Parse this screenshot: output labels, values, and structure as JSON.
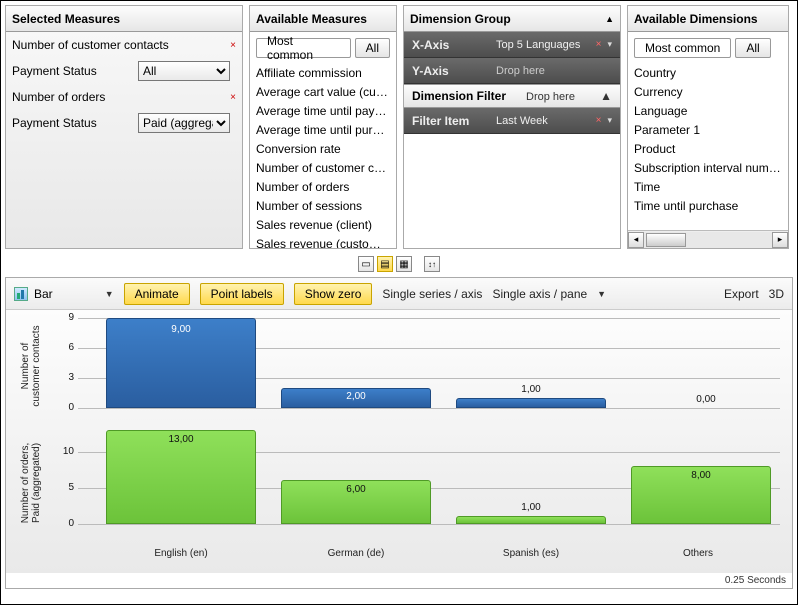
{
  "selected_measures": {
    "header": "Selected Measures",
    "rows": [
      {
        "label": "Number of customer contacts",
        "del": "×"
      },
      {
        "label": "Payment Status",
        "combo_value": "All"
      },
      {
        "label": "Number of orders",
        "del": "×"
      },
      {
        "label2": "Payment Status",
        "combo_value2": "Paid (aggrega"
      }
    ]
  },
  "available_measures": {
    "header": "Available Measures",
    "tabs": {
      "common": "Most common",
      "all": "All"
    },
    "items": [
      "Affiliate commission",
      "Average cart value (cus…",
      "Average time until pay…",
      "Average time until purc…",
      "Conversion rate",
      "Number of customer c…",
      "Number of orders",
      "Number of sessions",
      "Sales revenue (client)",
      "Sales revenue (customer)"
    ]
  },
  "dimension_group": {
    "header": "Dimension Group",
    "x_label": "X-Axis",
    "x_value": "Top 5 Languages",
    "y_label": "Y-Axis",
    "y_value": "Drop here",
    "filter_header": "Dimension Filter",
    "filter_hint": "Drop here",
    "filter_item_label": "Filter Item",
    "filter_item_value": "Last Week"
  },
  "available_dimensions": {
    "header": "Available Dimensions",
    "tabs": {
      "common": "Most common",
      "all": "All"
    },
    "items": [
      "Country",
      "Currency",
      "Language",
      "Parameter 1",
      "Product",
      "Subscription interval numbe",
      "Time",
      "Time until purchase"
    ]
  },
  "chart_toolbar": {
    "type_label": "Bar",
    "animate": "Animate",
    "point_labels": "Point labels",
    "show_zero": "Show zero",
    "single_series": "Single series / axis",
    "single_axis": "Single axis / pane",
    "export": "Export",
    "three_d": "3D"
  },
  "chart_data": [
    {
      "type": "bar",
      "ylabel": "Number of\ncustomer contacts",
      "categories": [
        "English (en)",
        "German (de)",
        "Spanish (es)",
        "Others"
      ],
      "values": [
        9.0,
        2.0,
        1.0,
        0.0
      ],
      "labels": [
        "9,00",
        "2,00",
        "1,00",
        "0,00"
      ],
      "yticks": [
        0,
        3,
        6,
        9
      ],
      "ylim": [
        0,
        9
      ]
    },
    {
      "type": "bar",
      "ylabel": "Number of orders,\nPaid (aggregated)",
      "categories": [
        "English (en)",
        "German (de)",
        "Spanish (es)",
        "Others"
      ],
      "values": [
        13.0,
        6.0,
        1.0,
        8.0
      ],
      "labels": [
        "13,00",
        "6,00",
        "1,00",
        "8,00"
      ],
      "yticks": [
        0,
        5,
        10
      ],
      "ylim": [
        0,
        14
      ]
    }
  ],
  "x_categories": [
    "English (en)",
    "German (de)",
    "Spanish (es)",
    "Others"
  ],
  "footer_time": "0.25 Seconds"
}
